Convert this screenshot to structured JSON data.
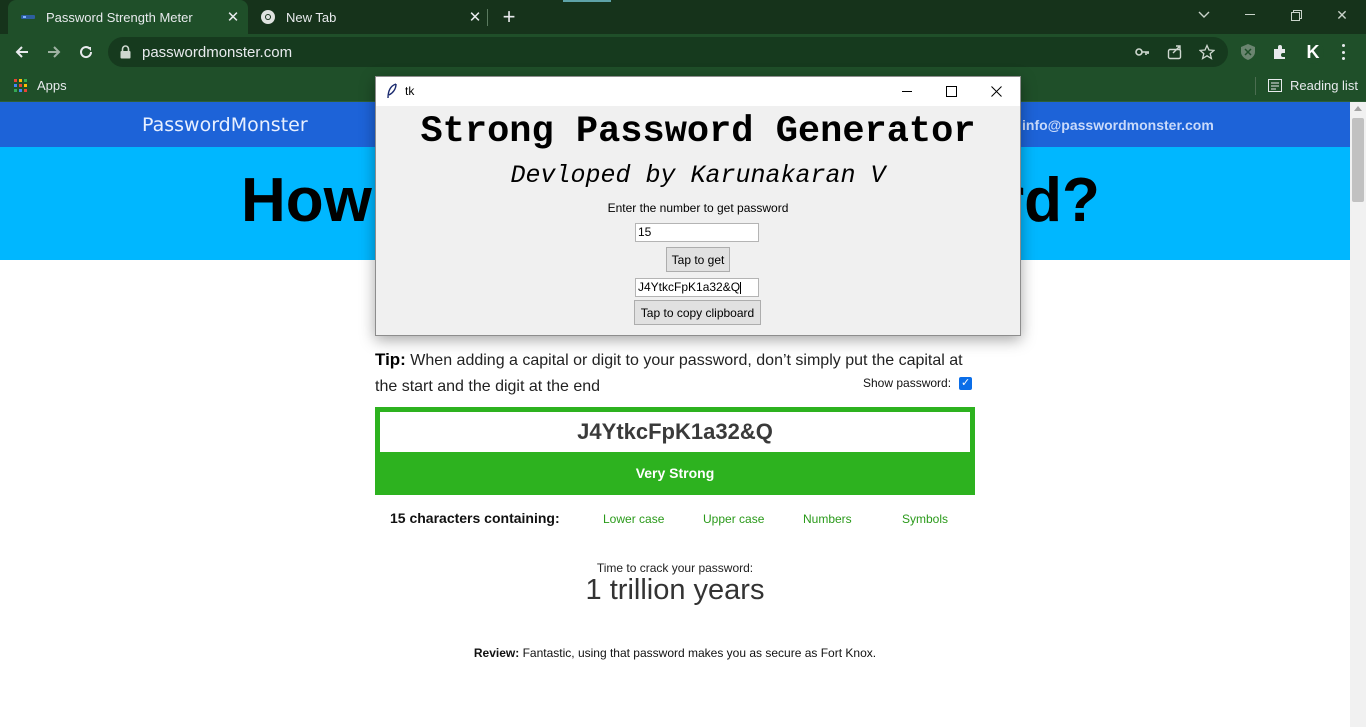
{
  "browser": {
    "tabs": [
      {
        "title": "Password Strength Meter",
        "active": true
      },
      {
        "title": "New Tab",
        "active": false
      }
    ],
    "url": "passwordmonster.com",
    "bookmarks": {
      "apps_label": "Apps",
      "reading_list_label": "Reading list"
    },
    "profile_initial": "K"
  },
  "site": {
    "brand": "PasswordMonster",
    "email": "info@passwordmonster.com",
    "hero_left": "How",
    "hero_right": "rd?",
    "tip_label": "Tip:",
    "tip_text": " When adding a capital or digit to your password, don’t simply put the capital at the start and the digit at the end",
    "show_password_label": "Show password:",
    "show_password_checked": true,
    "password_display": "J4YtkcFpK1a32&Q",
    "strength": "Very Strong",
    "strength_color": "#2db21f",
    "chars_summary": "15 characters containing:",
    "char_types": [
      "Lower case",
      "Upper case",
      "Numbers",
      "Symbols"
    ],
    "crack_label": "Time to crack your password:",
    "crack_value": "1 trillion years",
    "review_label": "Review:",
    "review_text": " Fantastic, using that password makes you as secure as Fort Knox."
  },
  "tk_window": {
    "title": "tk",
    "heading": "Strong Password Generator",
    "subheading": "Devloped by Karunakaran V",
    "prompt": "Enter the number to get password",
    "number_value": "15",
    "get_button": "Tap to get",
    "output_value": "J4YtkcFpK1a32&Q",
    "copy_button": "Tap to copy clipboard"
  },
  "colors": {
    "tab_strip": "#16331b",
    "toolbar": "#1f4f29",
    "site_nav": "#1d63d8",
    "hero": "#00b7ff"
  }
}
